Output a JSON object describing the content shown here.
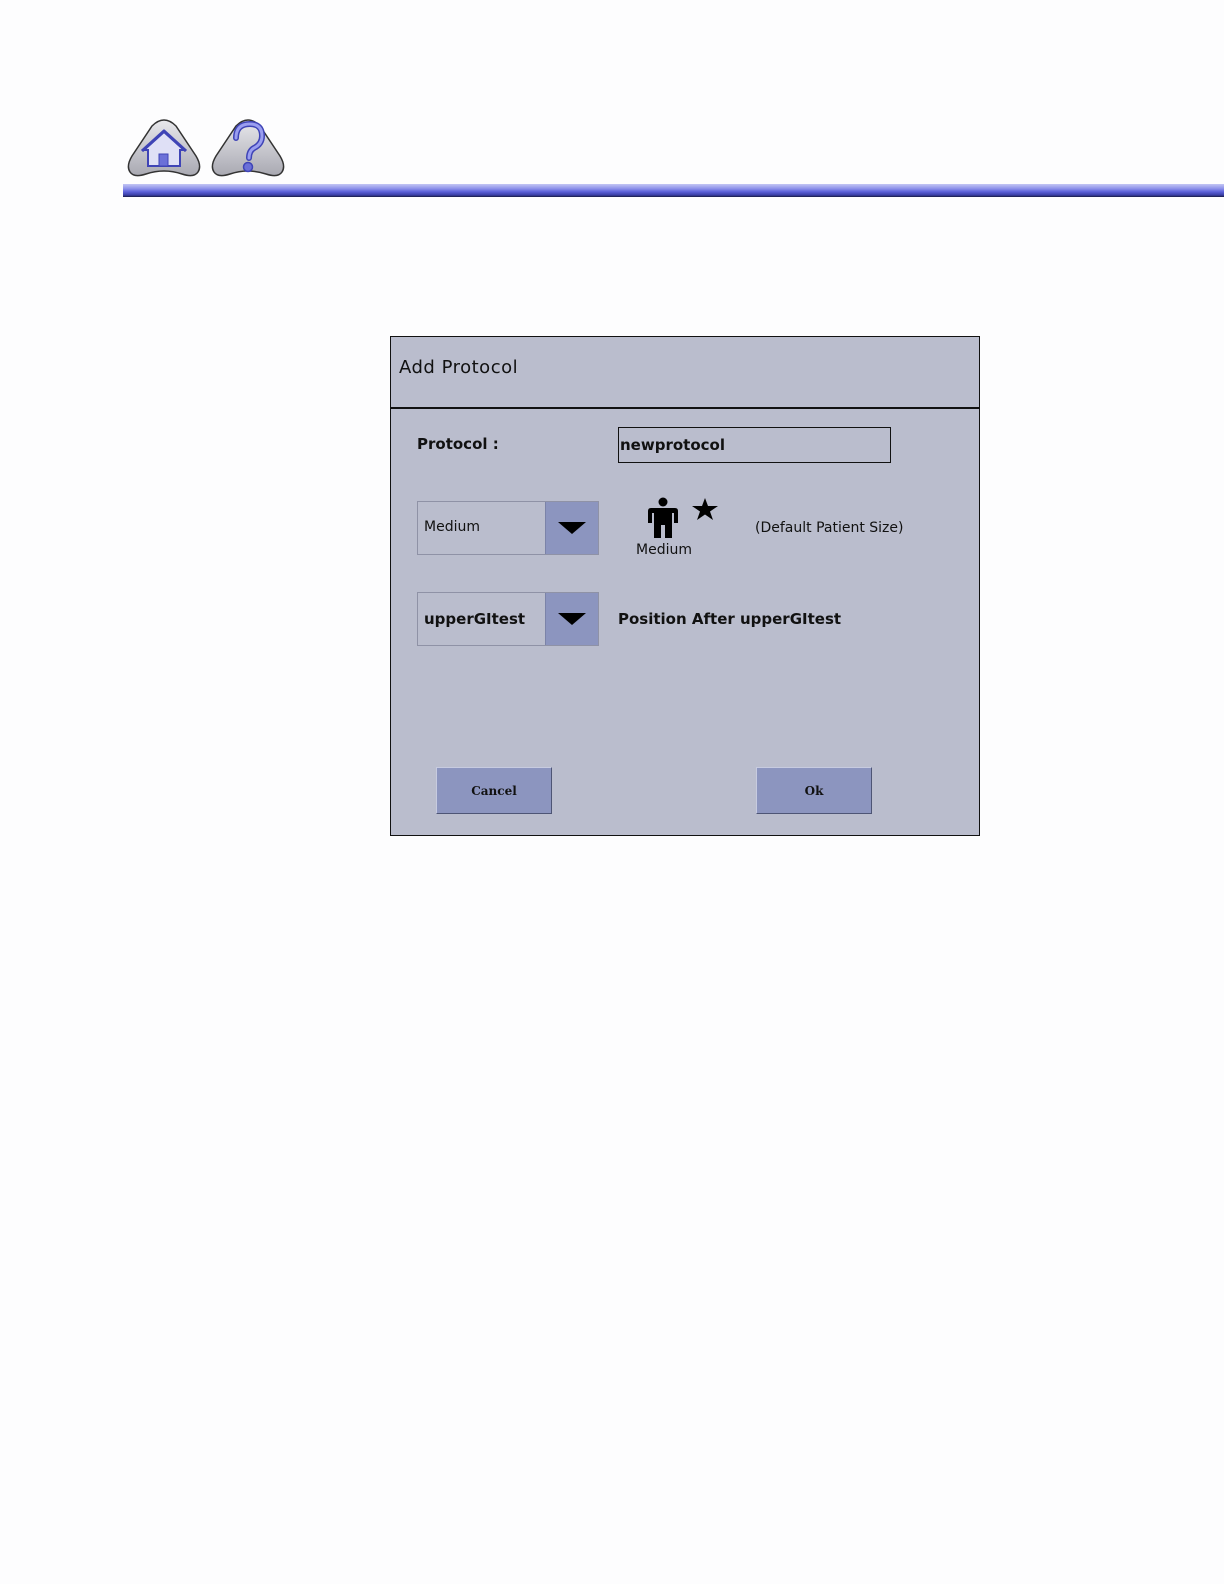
{
  "header": {
    "home_icon": "home-icon",
    "help_icon": "help-icon"
  },
  "dialog": {
    "title": "Add Protocol",
    "protocol_label": "Protocol :",
    "protocol_value": "newprotocol",
    "size_dropdown": {
      "selected": "Medium"
    },
    "patient_size": {
      "icon": "patient-figure-icon",
      "marker": "star-icon",
      "label": "Medium",
      "default_note": "(Default Patient Size)"
    },
    "position_dropdown": {
      "selected": "upperGItest"
    },
    "position_label": "Position After upperGItest",
    "cancel_label": "Cancel",
    "ok_label": "Ok"
  },
  "colors": {
    "dialog_bg": "#babdcd",
    "button_bg": "#8c95bf",
    "header_rule": "#5b60d9"
  }
}
